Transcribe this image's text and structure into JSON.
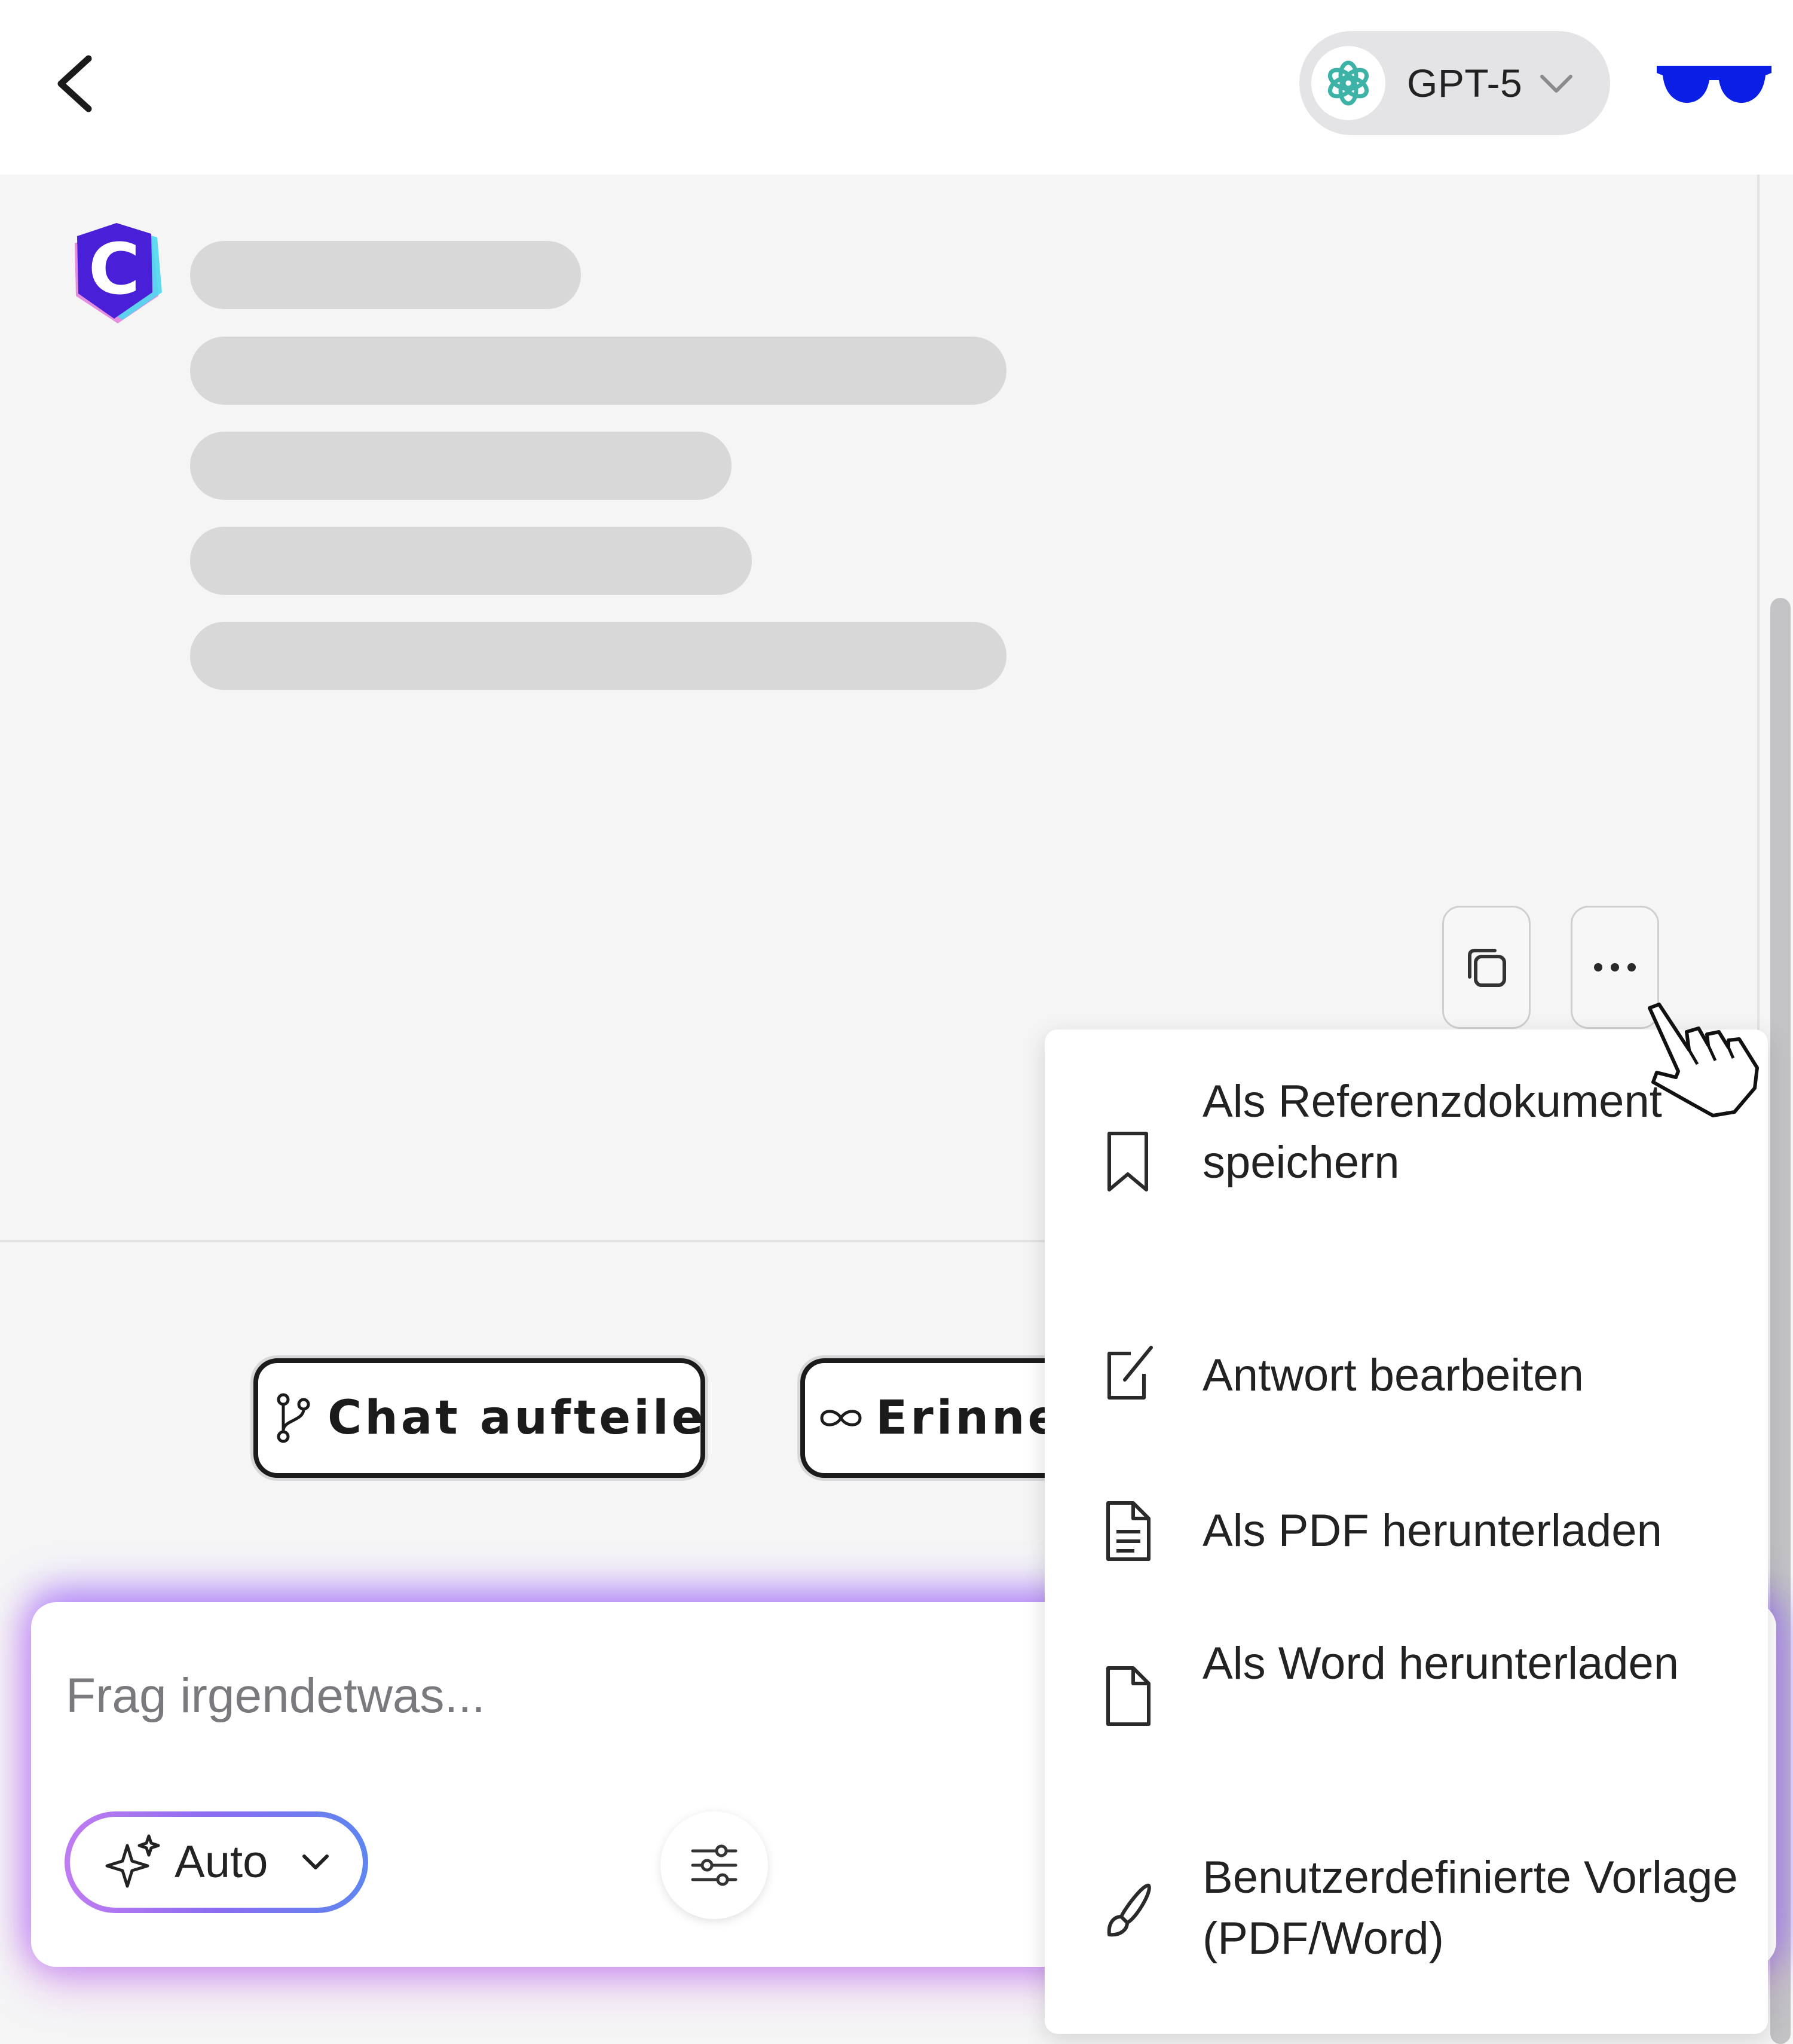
{
  "header": {
    "model": {
      "label": "GPT-5",
      "icon": "openai-logo-icon"
    }
  },
  "thread": {
    "assistant_avatar_letter": "C"
  },
  "message_actions": {
    "copy_icon": "copy-icon",
    "more_icon": "more-dots-icon"
  },
  "suggestions": [
    {
      "label": "Chat aufteilen",
      "icon": "branch-icon"
    },
    {
      "label": "Erinnerung",
      "icon": "infinity-icon"
    }
  ],
  "composer": {
    "placeholder": "Frag irgendetwas...",
    "mode_label": "Auto",
    "mode_icon": "sparkles-icon",
    "settings_icon": "sliders-icon"
  },
  "menu": {
    "items": [
      {
        "label": "Als Referenzdokument speichern",
        "icon": "bookmark-icon"
      },
      {
        "label": "Antwort bearbeiten",
        "icon": "edit-icon"
      },
      {
        "label": "Als PDF herunterladen",
        "icon": "file-text-icon"
      },
      {
        "label": "Als Word herunterladen",
        "icon": "file-icon"
      },
      {
        "label": "Benutzerdefinierte Vorlage (PDF/Word)",
        "icon": "brush-icon"
      }
    ]
  },
  "colors": {
    "brand_purple": "#4a1fd8",
    "glasses_blue": "#0a1ee6",
    "openai_teal": "#3cb3a6"
  }
}
